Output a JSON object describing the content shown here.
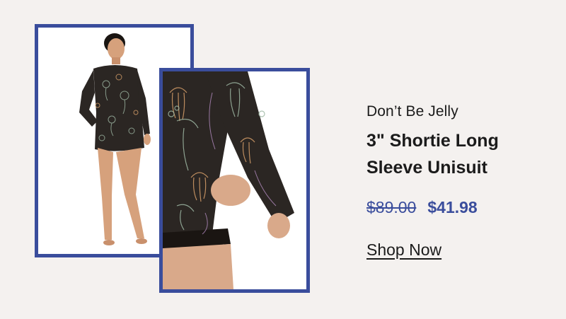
{
  "product": {
    "subtitle": "Don’t Be Jelly",
    "title_line1": "3\" Shortie Long",
    "title_line2": "Sleeve Unisuit",
    "price_original": "$89.00",
    "price_sale": "$41.98",
    "cta_label": "Shop Now"
  },
  "colors": {
    "accent": "#3a4d9c",
    "background": "#f4f1ef",
    "text": "#1b1b1b"
  },
  "images": [
    {
      "name": "model-full-body-photo"
    },
    {
      "name": "sleeve-detail-photo"
    }
  ]
}
